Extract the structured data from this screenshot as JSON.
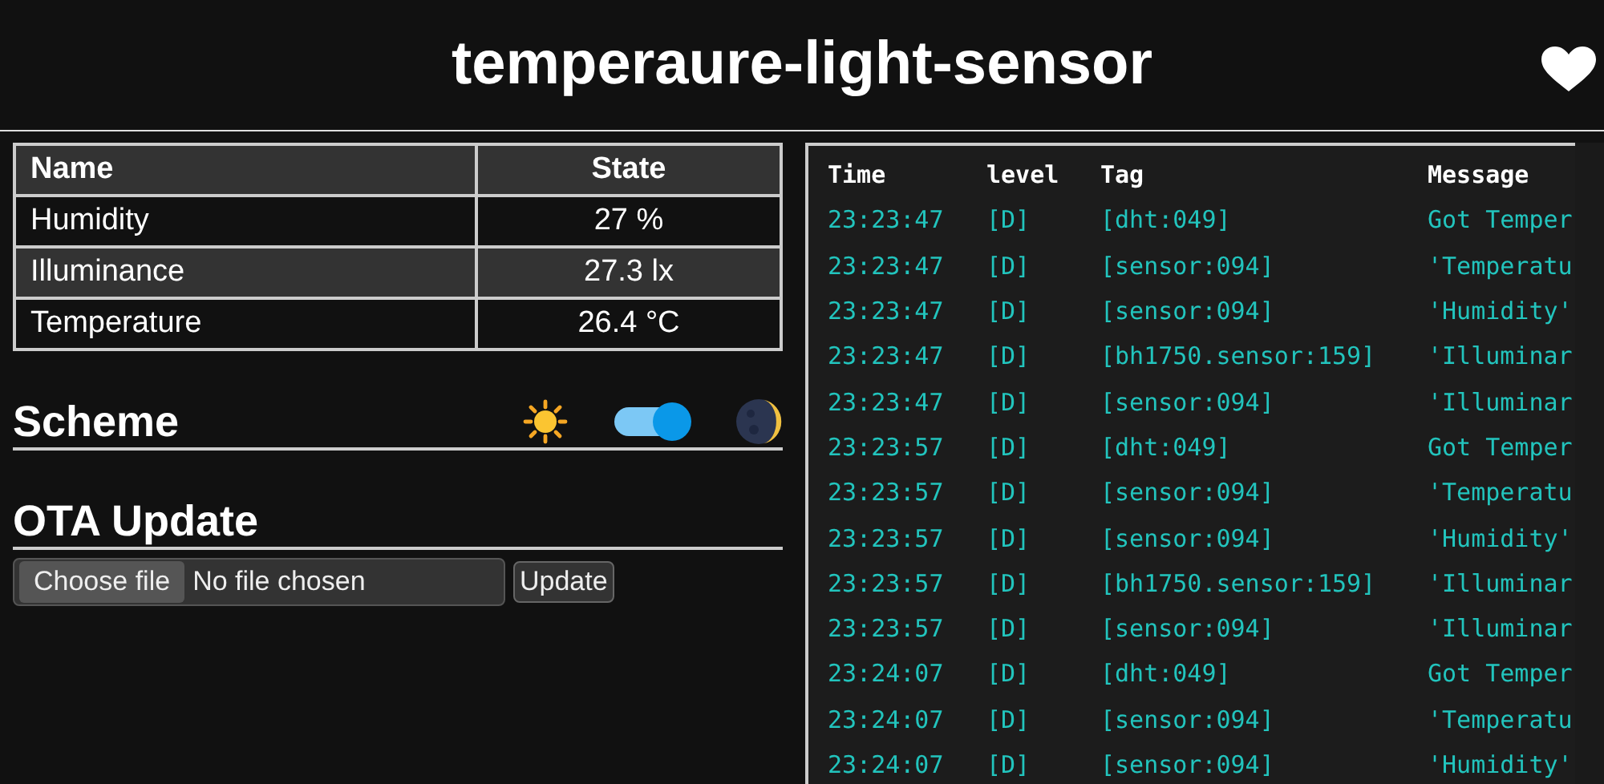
{
  "header": {
    "title": "temperaure-light-sensor"
  },
  "sensors": {
    "columns": [
      "Name",
      "State"
    ],
    "rows": [
      {
        "name": "Humidity",
        "state": "27 %"
      },
      {
        "name": "Illuminance",
        "state": "27.3 lx"
      },
      {
        "name": "Temperature",
        "state": "26.4 °C"
      }
    ]
  },
  "scheme": {
    "title": "Scheme",
    "dark": true
  },
  "ota": {
    "title": "OTA Update",
    "choose_button": "Choose file",
    "file_status": "No file chosen",
    "update_button": "Update"
  },
  "log": {
    "columns": [
      "Time",
      "level",
      "Tag",
      "Message"
    ],
    "rows": [
      {
        "time": "23:23:47",
        "level": "[D]",
        "tag": "[dht:049]",
        "message": "Got Temper"
      },
      {
        "time": "23:23:47",
        "level": "[D]",
        "tag": "[sensor:094]",
        "message": "'Temperatu"
      },
      {
        "time": "23:23:47",
        "level": "[D]",
        "tag": "[sensor:094]",
        "message": "'Humidity'"
      },
      {
        "time": "23:23:47",
        "level": "[D]",
        "tag": "[bh1750.sensor:159]",
        "message": "'Illuminar"
      },
      {
        "time": "23:23:47",
        "level": "[D]",
        "tag": "[sensor:094]",
        "message": "'Illuminar"
      },
      {
        "time": "23:23:57",
        "level": "[D]",
        "tag": "[dht:049]",
        "message": "Got Temper"
      },
      {
        "time": "23:23:57",
        "level": "[D]",
        "tag": "[sensor:094]",
        "message": "'Temperatu"
      },
      {
        "time": "23:23:57",
        "level": "[D]",
        "tag": "[sensor:094]",
        "message": "'Humidity'"
      },
      {
        "time": "23:23:57",
        "level": "[D]",
        "tag": "[bh1750.sensor:159]",
        "message": "'Illuminar"
      },
      {
        "time": "23:23:57",
        "level": "[D]",
        "tag": "[sensor:094]",
        "message": "'Illuminar"
      },
      {
        "time": "23:24:07",
        "level": "[D]",
        "tag": "[dht:049]",
        "message": "Got Temper"
      },
      {
        "time": "23:24:07",
        "level": "[D]",
        "tag": "[sensor:094]",
        "message": "'Temperatu"
      },
      {
        "time": "23:24:07",
        "level": "[D]",
        "tag": "[sensor:094]",
        "message": "'Humidity'"
      }
    ]
  }
}
